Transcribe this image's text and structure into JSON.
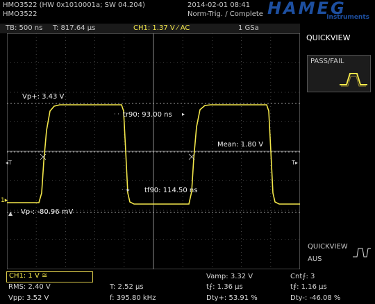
{
  "header": {
    "device_line1": "HMO3522 (HW 0x1010001a; SW 04.204)",
    "device_line2": "HMO3522",
    "datetime": "2014-02-01 08:41",
    "trigger_status": "Norm-Trig. / Complete",
    "logo_text": "HAMEG",
    "logo_sub": "Instruments"
  },
  "topbar": {
    "timebase": "TB: 500 ns",
    "trigger_time": "T: 817.64 µs",
    "channel": "CH1: 1.37 V ⁄ AC",
    "sample_rate": "1 GSa"
  },
  "cursors": {
    "vp_plus": "Vp+: 3.43 V",
    "vp_minus": "Vp-: -80.96 mV",
    "mean": "Mean: 1.80 V",
    "tr90": "tr90: 93.00 ns",
    "tf90": "tf90: 114.50 ns"
  },
  "side": {
    "quickview_label": "QUICKVIEW",
    "passfail_label": "PASS/FAIL",
    "quickview_bottom": "QUICKVIEW",
    "aus_label": "AUS"
  },
  "bottom": {
    "ch1_setting": "CH1: 1 V ≅",
    "rms": "RMS: 2.40 V",
    "vpp": "Vpp: 3.52 V",
    "period": "T: 2.52 µs",
    "frequency": "f: 395.80 kHz",
    "vamp": "Vamp: 3.32 V",
    "rise": "t⨍: 1.36 µs",
    "dty_plus": "Dty+: 53.91 %",
    "cnt": "Cnt⨍: 3",
    "fall": "t⨎: 1.16 µs",
    "dty_minus": "Dty-: -46.08 %"
  },
  "colors": {
    "trace": "#f2e64a",
    "grid": "#5a5a5a",
    "brand": "#1d4fa0"
  }
}
